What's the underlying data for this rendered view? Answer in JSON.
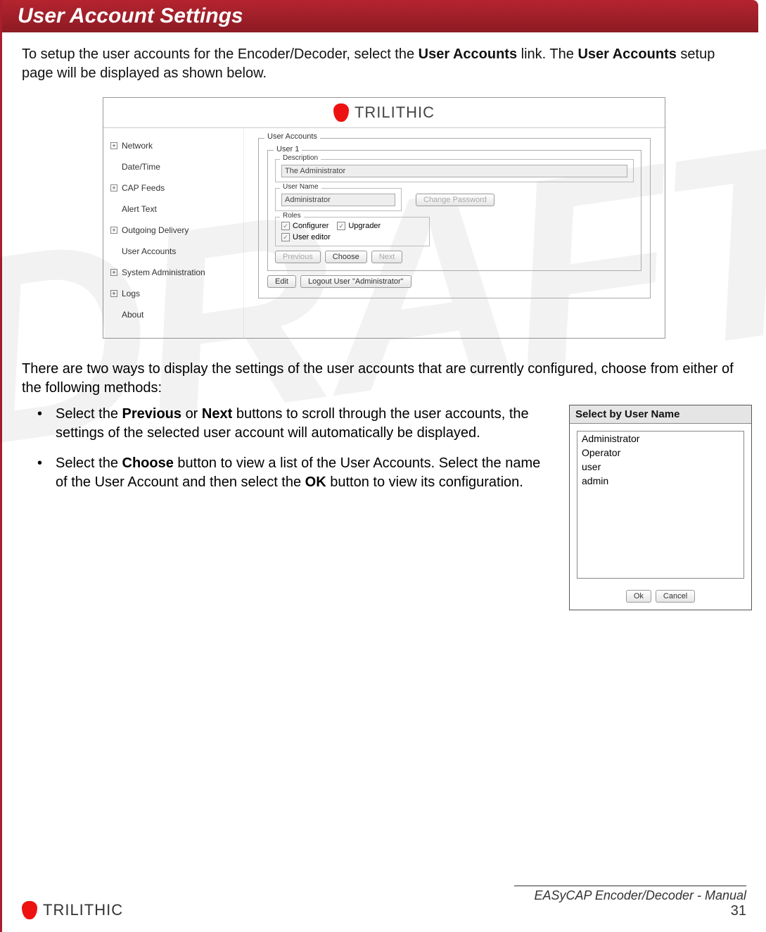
{
  "header": {
    "title": "User Account Settings"
  },
  "intro": {
    "pre": "To setup the user accounts for the Encoder/Decoder, select the ",
    "link1": "User Accounts",
    "mid": " link. The ",
    "link2": "User Accounts",
    "post": " setup page will be displayed as shown below."
  },
  "app": {
    "brand": "TRILITHIC",
    "nav": [
      {
        "label": "Network",
        "exp": true
      },
      {
        "label": "Date/Time",
        "exp": false
      },
      {
        "label": "CAP Feeds",
        "exp": true
      },
      {
        "label": "Alert Text",
        "exp": false
      },
      {
        "label": "Outgoing Delivery",
        "exp": true
      },
      {
        "label": "User Accounts",
        "exp": false
      },
      {
        "label": "System Administration",
        "exp": true
      },
      {
        "label": "Logs",
        "exp": true
      },
      {
        "label": "About",
        "exp": false
      }
    ],
    "panel_title": "User Accounts",
    "user_title": "User 1",
    "description_label": "Description",
    "description_value": "The Administrator",
    "username_label": "User Name",
    "username_value": "Administrator",
    "change_pw": "Change Password",
    "roles_label": "Roles",
    "roles": [
      "Configurer",
      "Upgrader",
      "User editor"
    ],
    "nav_btns": {
      "prev": "Previous",
      "choose": "Choose",
      "next": "Next"
    },
    "action_btns": {
      "edit": "Edit",
      "logout": "Logout User \"Administrator\""
    }
  },
  "para2": "There are two ways to display the settings of the user accounts that are currently configured, choose from either of the following methods:",
  "bullet1": {
    "pre": "Select the ",
    "b1": "Previous",
    "mid1": " or ",
    "b2": "Next",
    "post": " buttons to scroll through the user accounts, the settings of the selected user account will automatically be displayed."
  },
  "bullet2": {
    "pre": "Select the ",
    "b1": "Choose",
    "mid": " button to view a list of the User Accounts. Select the name of the User Account and then select the ",
    "b2": "OK",
    "post": " button to view its configuration."
  },
  "selectbox": {
    "title": "Select by User Name",
    "options": [
      "Administrator",
      "Operator",
      "user",
      "admin"
    ],
    "ok": "Ok",
    "cancel": "Cancel"
  },
  "footer": {
    "brand": "TRILITHIC",
    "manual": "EASyCAP Encoder/Decoder - Manual",
    "page": "31"
  },
  "watermark": "DRAFT"
}
